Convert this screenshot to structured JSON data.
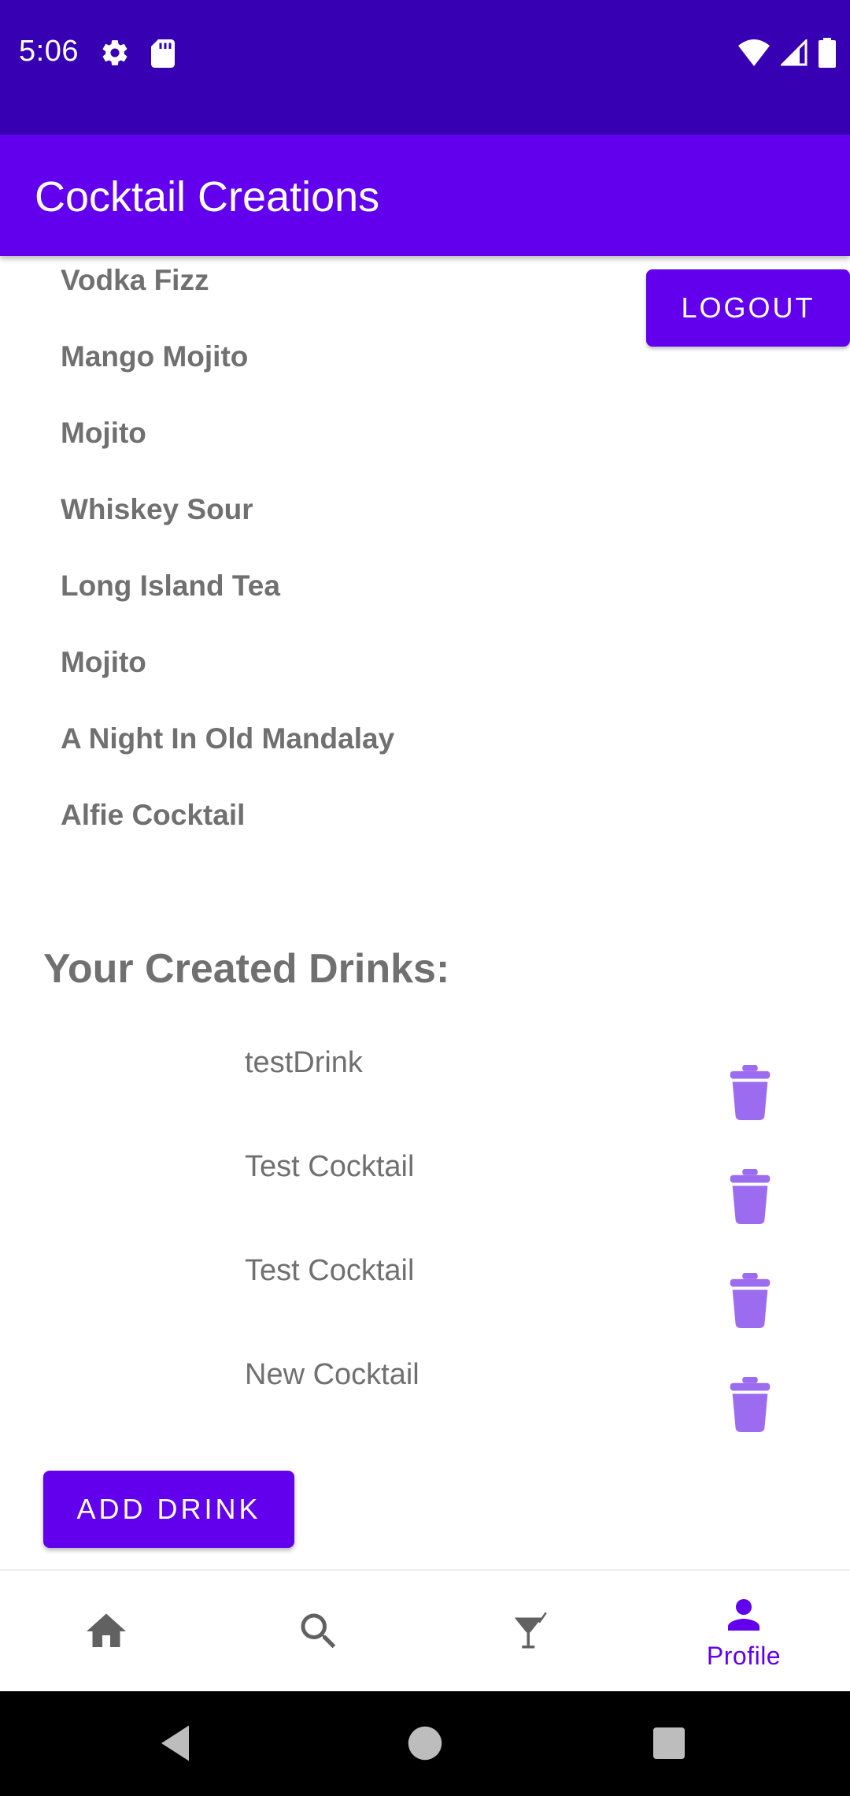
{
  "status_bar": {
    "time": "5:06",
    "icons": [
      "gear-icon",
      "sd-card-icon",
      "wifi-icon",
      "cell-signal-icon",
      "battery-icon"
    ]
  },
  "app_bar": {
    "title": "Cocktail Creations"
  },
  "logout_label": "LOGOUT",
  "favorites": [
    "Vodka Fizz",
    "Mango Mojito",
    "Mojito",
    "Whiskey Sour",
    "Long Island Tea",
    "Mojito",
    "A Night In Old Mandalay",
    "Alfie Cocktail"
  ],
  "created_section": {
    "heading": "Your Created Drinks:",
    "drinks": [
      "testDrink",
      "Test Cocktail",
      "Test Cocktail",
      "New Cocktail"
    ]
  },
  "add_drink_label": "ADD DRINK",
  "bottom_nav": {
    "items": [
      {
        "icon": "home-icon",
        "label": ""
      },
      {
        "icon": "search-icon",
        "label": ""
      },
      {
        "icon": "cocktail-icon",
        "label": ""
      },
      {
        "icon": "person-icon",
        "label": "Profile",
        "selected": true
      }
    ]
  },
  "colors": {
    "status_bar": "#3700b3",
    "primary": "#6200ee",
    "trash": "#9c6cf0",
    "text_gray": "#707070"
  }
}
